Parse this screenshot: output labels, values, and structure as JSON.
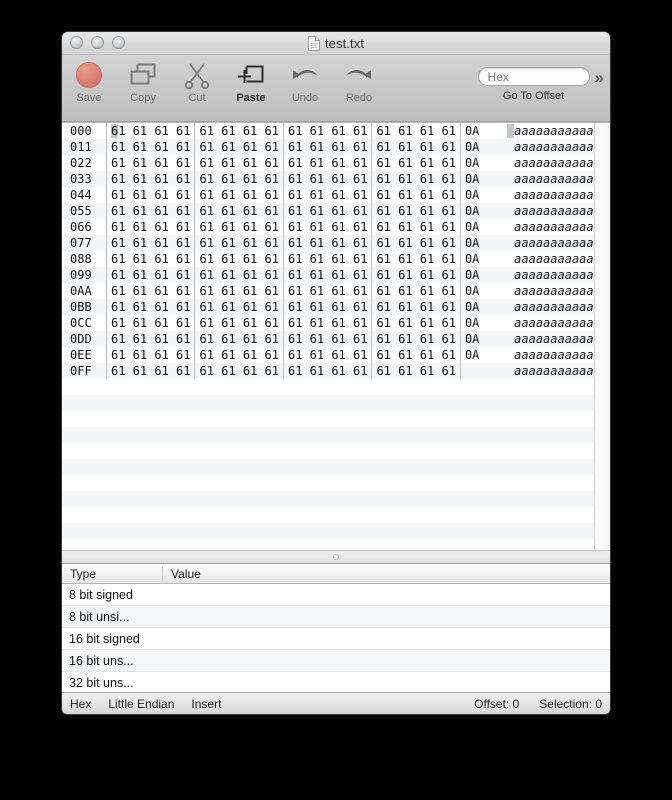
{
  "window": {
    "title": "test.txt",
    "doc_icon": "document-icon",
    "traffic_lights": [
      "close",
      "minimize",
      "zoom"
    ]
  },
  "toolbar": {
    "items": [
      {
        "label": "Save",
        "icon": "save-red-dot-icon",
        "enabled": false
      },
      {
        "label": "Copy",
        "icon": "copy-icon",
        "enabled": false
      },
      {
        "label": "Cut",
        "icon": "scissors-icon",
        "enabled": false
      },
      {
        "label": "Paste",
        "icon": "paste-icon",
        "enabled": true
      },
      {
        "label": "Undo",
        "icon": "undo-arrow-icon",
        "enabled": false
      },
      {
        "label": "Redo",
        "icon": "redo-arrow-icon",
        "enabled": false
      }
    ],
    "goto": {
      "placeholder": "Hex",
      "value": "",
      "label": "Go To Offset"
    },
    "overflow_chevron": "»"
  },
  "hex_view": {
    "bytes_per_row": 17,
    "group_size": 4,
    "rows": [
      {
        "offset": "000",
        "groups": [
          "61 61 61 61",
          "61 61 61 61",
          "61 61 61 61",
          "61 61 61 61"
        ],
        "tail": "0A",
        "ascii": "aaaaaaaaaaaaaaaa."
      },
      {
        "offset": "011",
        "groups": [
          "61 61 61 61",
          "61 61 61 61",
          "61 61 61 61",
          "61 61 61 61"
        ],
        "tail": "0A",
        "ascii": "aaaaaaaaaaaaaaaa."
      },
      {
        "offset": "022",
        "groups": [
          "61 61 61 61",
          "61 61 61 61",
          "61 61 61 61",
          "61 61 61 61"
        ],
        "tail": "0A",
        "ascii": "aaaaaaaaaaaaaaaa."
      },
      {
        "offset": "033",
        "groups": [
          "61 61 61 61",
          "61 61 61 61",
          "61 61 61 61",
          "61 61 61 61"
        ],
        "tail": "0A",
        "ascii": "aaaaaaaaaaaaaaaa."
      },
      {
        "offset": "044",
        "groups": [
          "61 61 61 61",
          "61 61 61 61",
          "61 61 61 61",
          "61 61 61 61"
        ],
        "tail": "0A",
        "ascii": "aaaaaaaaaaaaaaaa."
      },
      {
        "offset": "055",
        "groups": [
          "61 61 61 61",
          "61 61 61 61",
          "61 61 61 61",
          "61 61 61 61"
        ],
        "tail": "0A",
        "ascii": "aaaaaaaaaaaaaaaa."
      },
      {
        "offset": "066",
        "groups": [
          "61 61 61 61",
          "61 61 61 61",
          "61 61 61 61",
          "61 61 61 61"
        ],
        "tail": "0A",
        "ascii": "aaaaaaaaaaaaaaaa."
      },
      {
        "offset": "077",
        "groups": [
          "61 61 61 61",
          "61 61 61 61",
          "61 61 61 61",
          "61 61 61 61"
        ],
        "tail": "0A",
        "ascii": "aaaaaaaaaaaaaaaa."
      },
      {
        "offset": "088",
        "groups": [
          "61 61 61 61",
          "61 61 61 61",
          "61 61 61 61",
          "61 61 61 61"
        ],
        "tail": "0A",
        "ascii": "aaaaaaaaaaaaaaaa."
      },
      {
        "offset": "099",
        "groups": [
          "61 61 61 61",
          "61 61 61 61",
          "61 61 61 61",
          "61 61 61 61"
        ],
        "tail": "0A",
        "ascii": "aaaaaaaaaaaaaaaa."
      },
      {
        "offset": "0AA",
        "groups": [
          "61 61 61 61",
          "61 61 61 61",
          "61 61 61 61",
          "61 61 61 61"
        ],
        "tail": "0A",
        "ascii": "aaaaaaaaaaaaaaaa."
      },
      {
        "offset": "0BB",
        "groups": [
          "61 61 61 61",
          "61 61 61 61",
          "61 61 61 61",
          "61 61 61 61"
        ],
        "tail": "0A",
        "ascii": "aaaaaaaaaaaaaaaa."
      },
      {
        "offset": "0CC",
        "groups": [
          "61 61 61 61",
          "61 61 61 61",
          "61 61 61 61",
          "61 61 61 61"
        ],
        "tail": "0A",
        "ascii": "aaaaaaaaaaaaaaaa."
      },
      {
        "offset": "0DD",
        "groups": [
          "61 61 61 61",
          "61 61 61 61",
          "61 61 61 61",
          "61 61 61 61"
        ],
        "tail": "0A",
        "ascii": "aaaaaaaaaaaaaaaa."
      },
      {
        "offset": "0EE",
        "groups": [
          "61 61 61 61",
          "61 61 61 61",
          "61 61 61 61",
          "61 61 61 61"
        ],
        "tail": "0A",
        "ascii": "aaaaaaaaaaaaaaaa."
      },
      {
        "offset": "0FF",
        "groups": [
          "61 61 61 61",
          "61 61 61 61",
          "61 61 61 61",
          "61 61 61 61"
        ],
        "tail": "",
        "ascii": "aaaaaaaaaaaaaaaa"
      }
    ],
    "empty_rows": 11,
    "cursor": {
      "row": 0,
      "hex_char_index": 0,
      "color": "#c2c6cb"
    }
  },
  "inspector": {
    "columns": [
      "Type",
      "Value"
    ],
    "rows": [
      {
        "type": "8 bit signed",
        "value": ""
      },
      {
        "type": "8 bit unsi...",
        "value": ""
      },
      {
        "type": "16 bit signed",
        "value": ""
      },
      {
        "type": "16 bit uns...",
        "value": ""
      },
      {
        "type": "32 bit uns...",
        "value": ""
      }
    ]
  },
  "status_bar": {
    "mode": "Hex",
    "endianness": "Little Endian",
    "edit_mode": "Insert",
    "offset": "Offset: 0",
    "selection": "Selection: 0"
  },
  "colors": {
    "background": "#000000",
    "window_chrome": "#cfcfcf",
    "save_dot": "#dd8276",
    "row_stripe": "#f3f5f7",
    "selection": "#c2c6cb"
  }
}
